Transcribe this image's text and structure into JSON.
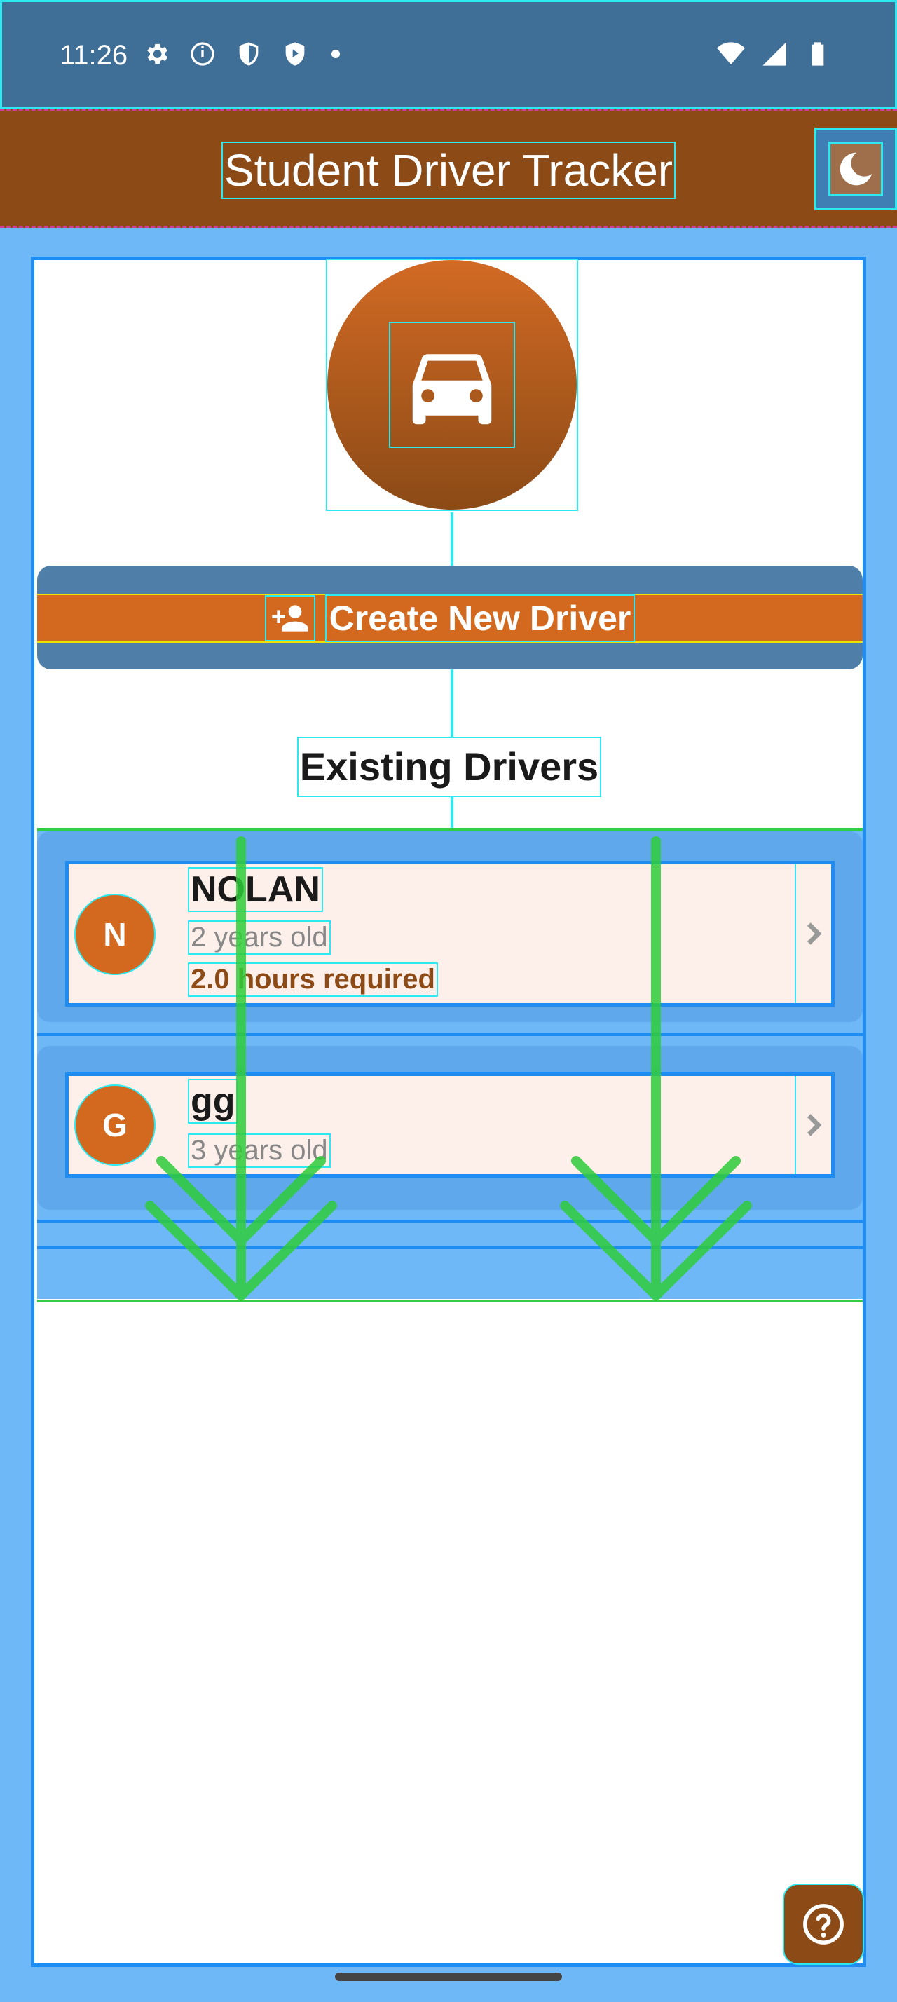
{
  "status_bar": {
    "time": "11:26",
    "left_icons": [
      "settings-icon",
      "info-icon",
      "shield-icon",
      "play-shield-icon",
      "dot-icon"
    ],
    "right_icons": [
      "wifi-icon",
      "signal-icon",
      "battery-icon"
    ]
  },
  "app_bar": {
    "title": "Student Driver Tracker",
    "theme_toggle_icon": "moon-icon",
    "background": "#8B4A16"
  },
  "main": {
    "logo_icon": "car-icon",
    "create_button": {
      "icon": "person-add-icon",
      "label": "Create New Driver",
      "color": "#D2691E"
    },
    "section_title": "Existing Drivers",
    "drivers": [
      {
        "initial": "N",
        "name": "NOLAN",
        "age": "2 years old",
        "hours_required": "2.0 hours required"
      },
      {
        "initial": "G",
        "name": "gg",
        "age": "3 years old"
      }
    ],
    "help_button_icon": "help-icon"
  },
  "colors": {
    "primary_dark": "#8B4A16",
    "primary": "#D2691E",
    "card_background": "#FDF0EA",
    "debug_outline": "#2EE8F0"
  }
}
